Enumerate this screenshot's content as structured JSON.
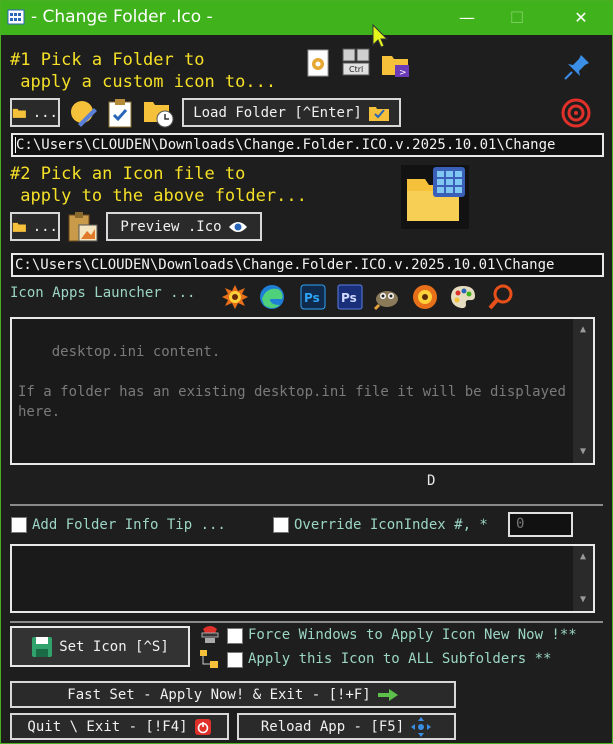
{
  "window": {
    "title": "- Change Folder .Ico -",
    "controls": {
      "minimize": "—",
      "maximize": "☐",
      "close": "✕"
    }
  },
  "step1": {
    "heading": "#1 Pick a Folder to\n apply a custom icon to...",
    "browse_label": "...",
    "load_folder_label": "Load Folder [^Enter]",
    "path_value": "C:\\Users\\CLOUDEN\\Downloads\\Change.Folder.ICO.v.2025.10.01\\Change"
  },
  "step2": {
    "heading": "#2 Pick an Icon file to\n apply to the above folder...",
    "browse_label": "...",
    "preview_label": "Preview .Ico",
    "path_value": "C:\\Users\\CLOUDEN\\Downloads\\Change.Folder.ICO.v.2025.10.01\\Change"
  },
  "launcher": {
    "label": "Icon Apps Launcher ...",
    "apps": [
      "xnview-icon",
      "edge-icon",
      "photoshop-icon",
      "photoshop-dark-icon",
      "gimp-icon",
      "xnview-icon",
      "paint-palette-icon",
      "magnifier-icon"
    ]
  },
  "desktop_ini": {
    "content": "desktop.ini content.\n\nIf a folder has an existing desktop.ini file it will be displayed here."
  },
  "drive_letter": "D",
  "options": {
    "folder_info_tip": "Add Folder Info Tip ...",
    "override_iconindex": "Override IconIndex #, *",
    "iconindex_placeholder": "0"
  },
  "actions": {
    "set_icon": "Set Icon [^S]",
    "force_windows": "Force Windows to Apply Icon New Now !**",
    "apply_subfolders": "Apply this Icon to ALL Subfolders **",
    "fast_set": "Fast Set - Apply Now! & Exit - [!+F]",
    "quit": "Quit \\ Exit - [!F4]",
    "reload": "Reload App - [F5]"
  },
  "colors": {
    "titlebar": "#3fb21c",
    "heading": "#f5e027",
    "label": "#9bd6c4",
    "background": "#1e1e1e"
  }
}
